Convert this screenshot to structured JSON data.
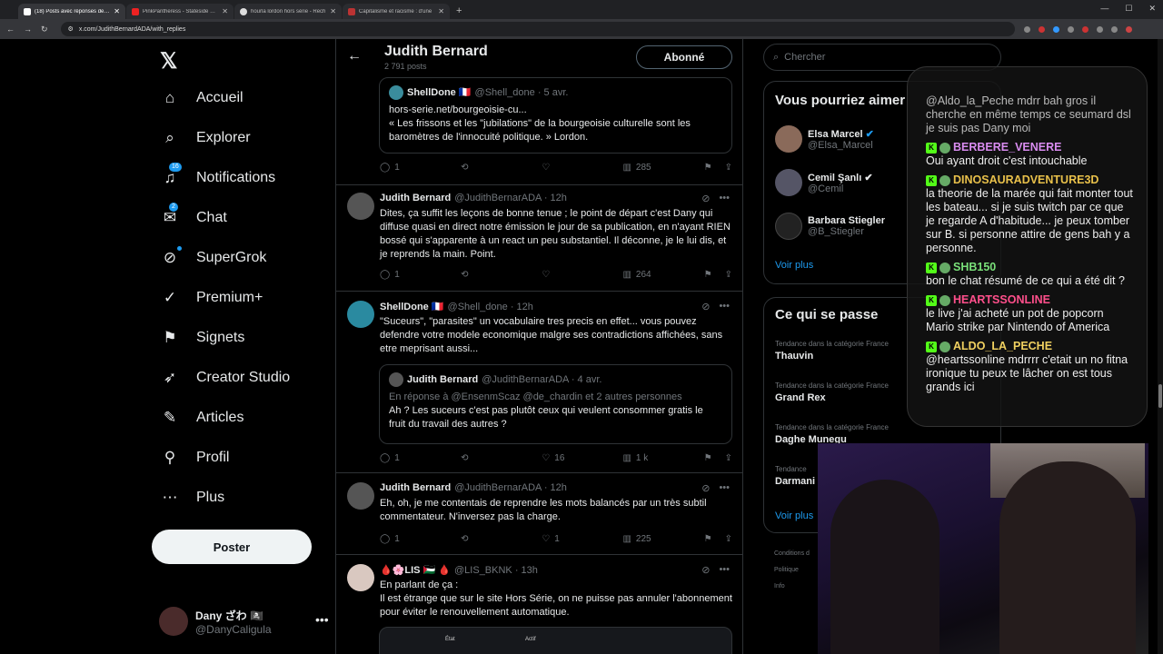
{
  "browser": {
    "tabs": [
      {
        "title": "(18) Posts avec réponses de Judi",
        "fav": "#222",
        "active": true
      },
      {
        "title": "PinkPantheress - Stateside + Za",
        "fav": "#e22",
        "active": false
      },
      {
        "title": "hourla lordon hors série - Rech",
        "fav": "#4a8",
        "active": false
      },
      {
        "title": "Capitalisme et racisme : d'une",
        "fav": "#b33",
        "active": false
      }
    ],
    "url": "x.com/JudithBernardADA/with_replies"
  },
  "nav": {
    "items": [
      {
        "label": "Accueil",
        "icon": "⌂"
      },
      {
        "label": "Explorer",
        "icon": "⌕"
      },
      {
        "label": "Notifications",
        "icon": "🔔︎",
        "badge": "16"
      },
      {
        "label": "Chat",
        "icon": "✉",
        "badge": "2"
      },
      {
        "label": "SuperGrok",
        "icon": "⊘"
      },
      {
        "label": "Premium+",
        "icon": "✓"
      },
      {
        "label": "Signets",
        "icon": "⚑"
      },
      {
        "label": "Creator Studio",
        "icon": "➶"
      },
      {
        "label": "Articles",
        "icon": "✎"
      },
      {
        "label": "Profil",
        "icon": "⚲"
      },
      {
        "label": "Plus",
        "icon": "⋯"
      }
    ],
    "post_label": "Poster",
    "me_name": "Dany ざわ 🏴‍☠️",
    "me_handle": "@DanyCaligula"
  },
  "profile": {
    "name": "Judith Bernard",
    "posts": "2 791 posts",
    "follow_label": "Abonné"
  },
  "feed": {
    "top_quote": {
      "name": "ShellDone 🇫🇷",
      "handle": "@Shell_done · 5 avr.",
      "line1": "hors-serie.net/bourgeoisie-cu...",
      "line2": "« Les frissons et les \"jubilations\" de la bourgeoisie culturelle sont les baromètres de l'innocuité politique. » Lordon.",
      "replies": "1",
      "views": "285"
    },
    "t1": {
      "name": "Judith Bernard",
      "handle": "@JudithBernarADA · 12h",
      "text": "Dites, ça suffit les leçons de bonne tenue ; le point de départ c'est Dany qui diffuse quasi en direct notre émission le jour de sa publication, en n'ayant RIEN bossé qui s'apparente à un react un peu substantiel. Il déconne, je le lui dis, et je reprends la main. Point.",
      "replies": "1",
      "views": "264"
    },
    "t2": {
      "name": "ShellDone 🇫🇷",
      "handle": "@Shell_done · 12h",
      "text": "\"Suceurs\", \"parasites\" un vocabulaire tres precis en effet... vous pouvez defendre votre modele economique malgre ses contradictions affichées, sans etre meprisant aussi...",
      "q_name": "Judith Bernard",
      "q_handle": "@JudithBernarADA · 4 avr.",
      "q_reply": "En réponse à @EnsenmScaz @de_chardin et 2 autres personnes",
      "q_text": "Ah ? Les suceurs c'est pas plutôt ceux qui veulent consommer gratis le fruit du travail des autres ?",
      "replies": "1",
      "likes": "16",
      "views": "1 k"
    },
    "t3": {
      "name": "Judith Bernard",
      "handle": "@JudithBernarADA · 12h",
      "text": "Eh, oh, je me contentais de reprendre les mots balancés par un très subtil commentateur. N'inversez pas la charge.",
      "replies": "1",
      "likes": "1",
      "views": "225"
    },
    "t4": {
      "name": "🩸🌸LIS 🇵🇸 🩸",
      "handle": "@LIS_BKNK · 13h",
      "text1": "En parlant de ça :",
      "text2": "Il est étrange que sur le site Hors Série, on ne puisse pas annuler l'abonnement pour éviter le renouvellement automatique.",
      "col1": "État",
      "col2": "Actif"
    }
  },
  "right": {
    "search_placeholder": "Chercher",
    "who_title": "Vous pourriez aimer",
    "who": [
      {
        "name": "Elsa Marcel",
        "handle": "@Elsa_Marcel",
        "color": "#8a6a5a"
      },
      {
        "name": "Cemil Şanlı",
        "handle": "@Cemil",
        "color": "#556"
      },
      {
        "name": "Barbara Stiegler",
        "handle": "@B_Stiegler",
        "color": "#222"
      }
    ],
    "see_more": "Voir plus",
    "trends_title": "Ce qui se passe",
    "trends": [
      {
        "cat": "Tendance dans la catégorie France",
        "name": "Thauvin"
      },
      {
        "cat": "Tendance dans la catégorie France",
        "name": "Grand Rex"
      },
      {
        "cat": "Tendance dans la catégorie France",
        "name": "Daghe Munegu"
      },
      {
        "cat": "Tendance",
        "name": "Darmani"
      }
    ],
    "see_more2": "Voir plus",
    "footer": [
      "Conditions d",
      "Politique",
      "Info"
    ]
  },
  "chat": {
    "messages": [
      {
        "user": "",
        "text": "@Aldo_la_Peche mdrr bah gros il cherche en même temps ce seumard dsl je suis pas Dany moi",
        "color": "#ccc"
      },
      {
        "user": "BERBERE_VENERE",
        "text": "Oui ayant droit c'est intouchable",
        "color": "#d98cf0"
      },
      {
        "user": "DINOSAURADVENTURE3D",
        "text": "la theorie de la marée qui fait monter tout les bateau... si je suis twitch par ce que je regarde A d'habitude... je peux tomber sur B. si personne attire de gens bah y a personne.",
        "color": "#e8c04a"
      },
      {
        "user": "SHB150",
        "text": "bon le chat résumé de ce qui a été dit ?",
        "color": "#7ae07a"
      },
      {
        "user": "HEARTSSONLINE",
        "text": "le live j'ai acheté un pot de popcorn Mario strike par Nintendo of America",
        "color": "#ff4f8b"
      },
      {
        "user": "ALDO_LA_PECHE",
        "text": "@heartssonline mdrrrr c'etait un no fitna ironique tu peux te lâcher on est tous grands ici",
        "color": "#f0d060"
      }
    ]
  }
}
